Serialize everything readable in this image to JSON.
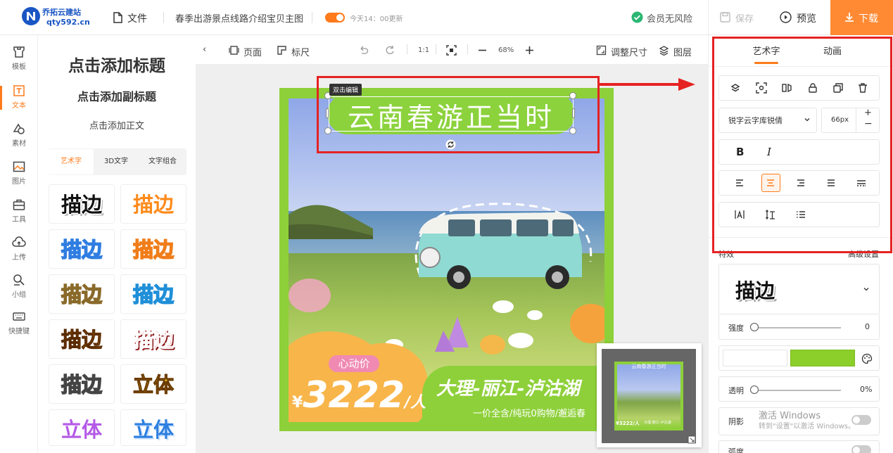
{
  "app": {
    "name": "乔拓云建站",
    "domain": "qty592.cn"
  },
  "topbar": {
    "file_label": "文件",
    "doc_title": "春季出游景点线路介绍宝贝主图",
    "autosave_on": true,
    "autosave_text": "今天14：00更新",
    "member_text": "会员无风险",
    "save_label": "保存",
    "preview_label": "预览",
    "download_label": "下载"
  },
  "leftnav": {
    "items": [
      {
        "label": "模板",
        "icon": "template-icon"
      },
      {
        "label": "文本",
        "icon": "text-icon",
        "active": true
      },
      {
        "label": "素材",
        "icon": "material-icon"
      },
      {
        "label": "图片",
        "icon": "image-icon"
      },
      {
        "label": "工具",
        "icon": "toolbox-icon"
      },
      {
        "label": "上传",
        "icon": "upload-icon"
      },
      {
        "label": "小组",
        "icon": "group-icon"
      },
      {
        "label": "快捷键",
        "icon": "keyboard-icon"
      }
    ]
  },
  "text_panel": {
    "add_title": "点击添加标题",
    "add_subtitle": "点击添加副标题",
    "add_body": "点击添加正文",
    "tabs": [
      "艺术字",
      "3D文字",
      "文字组合"
    ],
    "active_tab": 0,
    "samples": [
      "描边",
      "描边",
      "描边",
      "描边",
      "描边",
      "描边",
      "描边",
      "描边",
      "描边",
      "立体",
      "立体",
      "立体"
    ]
  },
  "canvas_toolbar": {
    "page_label": "页面",
    "ruler_label": "标尺",
    "ratio_label": "1:1",
    "zoom_value": "68%",
    "resize_label": "调整尺寸",
    "layers_label": "图层"
  },
  "poster": {
    "edit_tag": "双击编辑",
    "headline": "云南春游正当时",
    "price_label": "心动价",
    "price_currency": "¥",
    "price_value": "3222",
    "price_unit": "/人",
    "route": "大理-丽江-泸沽湖",
    "subline": "一价全含/纯玩0购物/邂逅春"
  },
  "minimap": {
    "title": "云南春游正当时",
    "price": "¥3222/人",
    "route": "大理-丽江-泸沽湖"
  },
  "right_panel": {
    "tabs": [
      "艺术字",
      "动画"
    ],
    "active_tab": 0,
    "font_name": "锐字云字库锐倩",
    "font_size": "66px",
    "bold_label": "B",
    "italic_label": "I",
    "effects_label": "特效",
    "advanced_label": "高级设置",
    "effect_preview": "描边",
    "strength_label": "强度",
    "strength_value": "0",
    "stroke_color": "#8cce2a",
    "opacity_label": "透明",
    "opacity_value": "0%",
    "shadow_label": "阴影",
    "radius_label": "弧度",
    "watermark_line1": "激活 Windows",
    "watermark_line2": "转到\"设置\"以激活 Windows。"
  },
  "colors": {
    "accent": "#ff7a1a",
    "download_bg": "#ff8a33",
    "annotation_red": "#e52222",
    "poster_green": "#8ed03a",
    "brand_blue": "#1a56c4"
  }
}
